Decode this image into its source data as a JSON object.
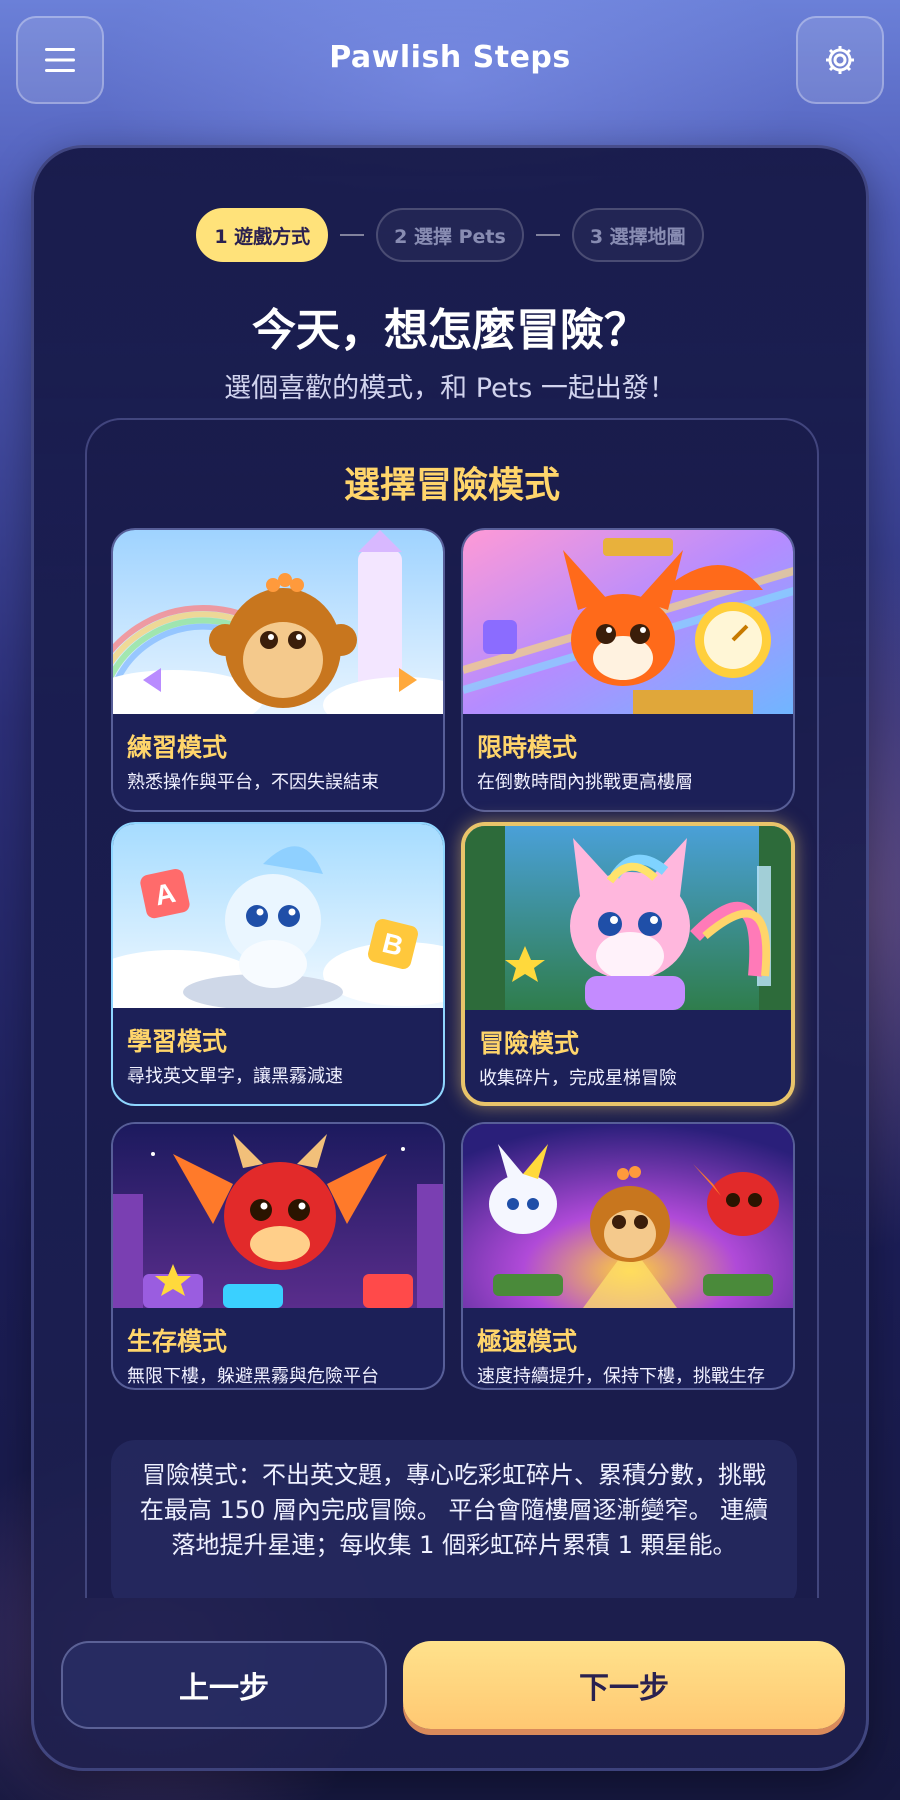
{
  "app": {
    "title": "Pawlish Steps"
  },
  "topbar": {
    "menu_icon": "menu-icon",
    "settings_icon": "gear-icon"
  },
  "steps": [
    {
      "label": "1 遊戲方式",
      "active": true
    },
    {
      "label": "2 選擇 Pets",
      "active": false
    },
    {
      "label": "3 選擇地圖",
      "active": false
    }
  ],
  "headline": "今天，想怎麼冒險？",
  "subhead": "選個喜歡的模式，和 Pets 一起出發！",
  "panel_title": "選擇冒險模式",
  "modes": [
    {
      "name": "練習模式",
      "desc": "熟悉操作與平台，不因失誤結束",
      "pet": "monkey"
    },
    {
      "name": "限時模式",
      "desc": "在倒數時間內挑戰更高樓層",
      "pet": "fox"
    },
    {
      "name": "學習模式",
      "desc": "尋找英文單字，讓黑霧減速",
      "pet": "water-fox"
    },
    {
      "name": "冒險模式",
      "desc": "收集碎片，完成星梯冒險",
      "pet": "rainbow-cat",
      "selected": true
    },
    {
      "name": "生存模式",
      "desc": "無限下樓，躲避黑霧與危險平台",
      "pet": "dragon"
    },
    {
      "name": "極速模式",
      "desc": "速度持續提升，保持下樓，挑戰生存紀錄",
      "pet": "team"
    }
  ],
  "description": "冒險模式：不出英文題，專心吃彩虹碎片、累積分數，挑戰在最高 150 層內完成冒險。 平台會隨樓層逐漸變窄。 連續落地提升星連；每收集 1 個彩虹碎片累積 1 顆星能。",
  "buttons": {
    "prev": "上一步",
    "next": "下一步"
  },
  "colors": {
    "accent": "#ffe27a",
    "mode_title": "#ffd56b",
    "next_button": "#ffd07a",
    "selected_border": "#e9c46a"
  }
}
